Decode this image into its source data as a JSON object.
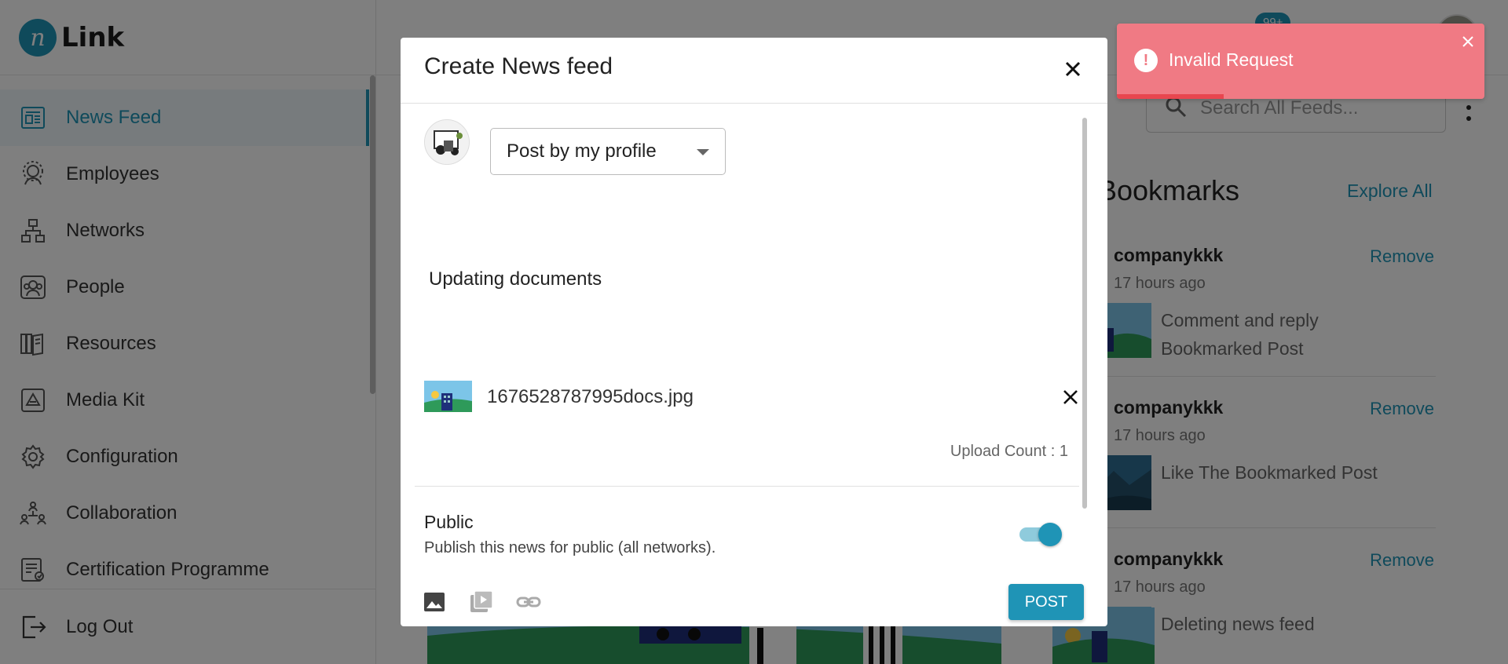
{
  "app": {
    "logo_mark": "n",
    "logo_text": "Link"
  },
  "sidebar": {
    "items": [
      {
        "label": "News Feed",
        "icon": "news-feed-icon",
        "active": true
      },
      {
        "label": "Employees",
        "icon": "employees-icon"
      },
      {
        "label": "Networks",
        "icon": "networks-icon"
      },
      {
        "label": "People",
        "icon": "people-icon"
      },
      {
        "label": "Resources",
        "icon": "resources-icon"
      },
      {
        "label": "Media Kit",
        "icon": "media-kit-icon"
      },
      {
        "label": "Configuration",
        "icon": "gear-icon"
      },
      {
        "label": "Collaboration",
        "icon": "collaboration-icon"
      },
      {
        "label": "Certification Programme",
        "icon": "certificate-icon"
      }
    ],
    "logout_label": "Log Out"
  },
  "header": {
    "notification_badge": "99+",
    "search_placeholder": "Search All Feeds..."
  },
  "bookmarks": {
    "title": "Bookmarks",
    "explore_label": "Explore All",
    "items": [
      {
        "user": "companykkk",
        "time": "17 hours ago",
        "remove_label": "Remove",
        "text": "Comment and reply Bookmarked Post"
      },
      {
        "user": "companykkk",
        "time": "17 hours ago",
        "remove_label": "Remove",
        "text": "Like The Bookmarked Post"
      },
      {
        "user": "companykkk",
        "time": "17 hours ago",
        "remove_label": "Remove",
        "text": "Deleting news feed"
      }
    ]
  },
  "modal": {
    "title": "Create News feed",
    "post_by_selected": "Post by my profile",
    "post_text": "Updating documents",
    "attachment_name": "1676528787995docs.jpg",
    "upload_count": "Upload Count : 1",
    "public_label": "Public",
    "public_description": "Publish this news for public (all networks).",
    "public_enabled": true,
    "post_button": "POST"
  },
  "toast": {
    "message": "Invalid Request",
    "type": "error",
    "progress": 0.29
  },
  "colors": {
    "accent": "#1f94b6",
    "toast_bg": "#f07a84",
    "toast_progress": "#e8464f"
  }
}
